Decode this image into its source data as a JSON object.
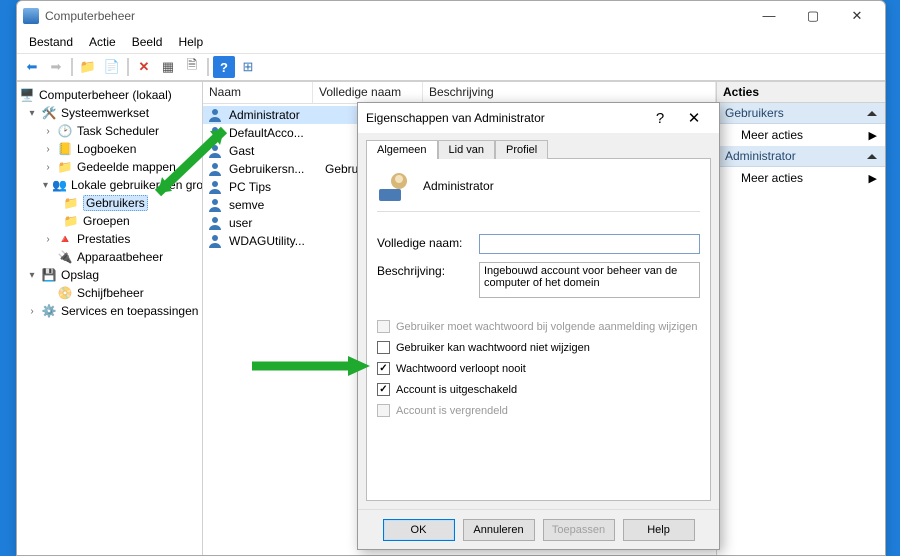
{
  "window": {
    "title": "Computerbeheer",
    "menu": [
      "Bestand",
      "Actie",
      "Beeld",
      "Help"
    ]
  },
  "tree": {
    "root": "Computerbeheer (lokaal)",
    "systeemwerkset": "Systeemwerkset",
    "task_scheduler": "Task Scheduler",
    "logboeken": "Logboeken",
    "gedeelde_mappen": "Gedeelde mappen",
    "lokale_gebruikers": "Lokale gebruikers en groepen",
    "gebruikers": "Gebruikers",
    "groepen": "Groepen",
    "prestaties": "Prestaties",
    "apparaatbeheer": "Apparaatbeheer",
    "opslag": "Opslag",
    "schijfbeheer": "Schijfbeheer",
    "services": "Services en toepassingen"
  },
  "list": {
    "col_naam": "Naam",
    "col_volledige": "Volledige naam",
    "col_beschrijving": "Beschrijving",
    "rows": [
      {
        "name": "Administrator",
        "full": ""
      },
      {
        "name": "DefaultAcco...",
        "full": ""
      },
      {
        "name": "Gast",
        "full": ""
      },
      {
        "name": "Gebruikersn...",
        "full": "Gebruikersn..."
      },
      {
        "name": "PC Tips",
        "full": ""
      },
      {
        "name": "semve",
        "full": ""
      },
      {
        "name": "user",
        "full": ""
      },
      {
        "name": "WDAGUtility...",
        "full": ""
      }
    ]
  },
  "actions": {
    "header": "Acties",
    "sec1": "Gebruikers",
    "item": "Meer acties",
    "sec2": "Administrator"
  },
  "dialog": {
    "title": "Eigenschappen van Administrator",
    "tabs": [
      "Algemeen",
      "Lid van",
      "Profiel"
    ],
    "username": "Administrator",
    "label_volledige": "Volledige naam:",
    "label_beschrijving": "Beschrijving:",
    "val_volledige": "",
    "val_beschrijving": "Ingebouwd account voor beheer van de computer of het domein",
    "chk1": "Gebruiker moet wachtwoord bij volgende aanmelding wijzigen",
    "chk2": "Gebruiker kan wachtwoord niet wijzigen",
    "chk3": "Wachtwoord verloopt nooit",
    "chk4": "Account is uitgeschakeld",
    "chk5": "Account is vergrendeld",
    "btn_ok": "OK",
    "btn_cancel": "Annuleren",
    "btn_apply": "Toepassen",
    "btn_help": "Help"
  }
}
